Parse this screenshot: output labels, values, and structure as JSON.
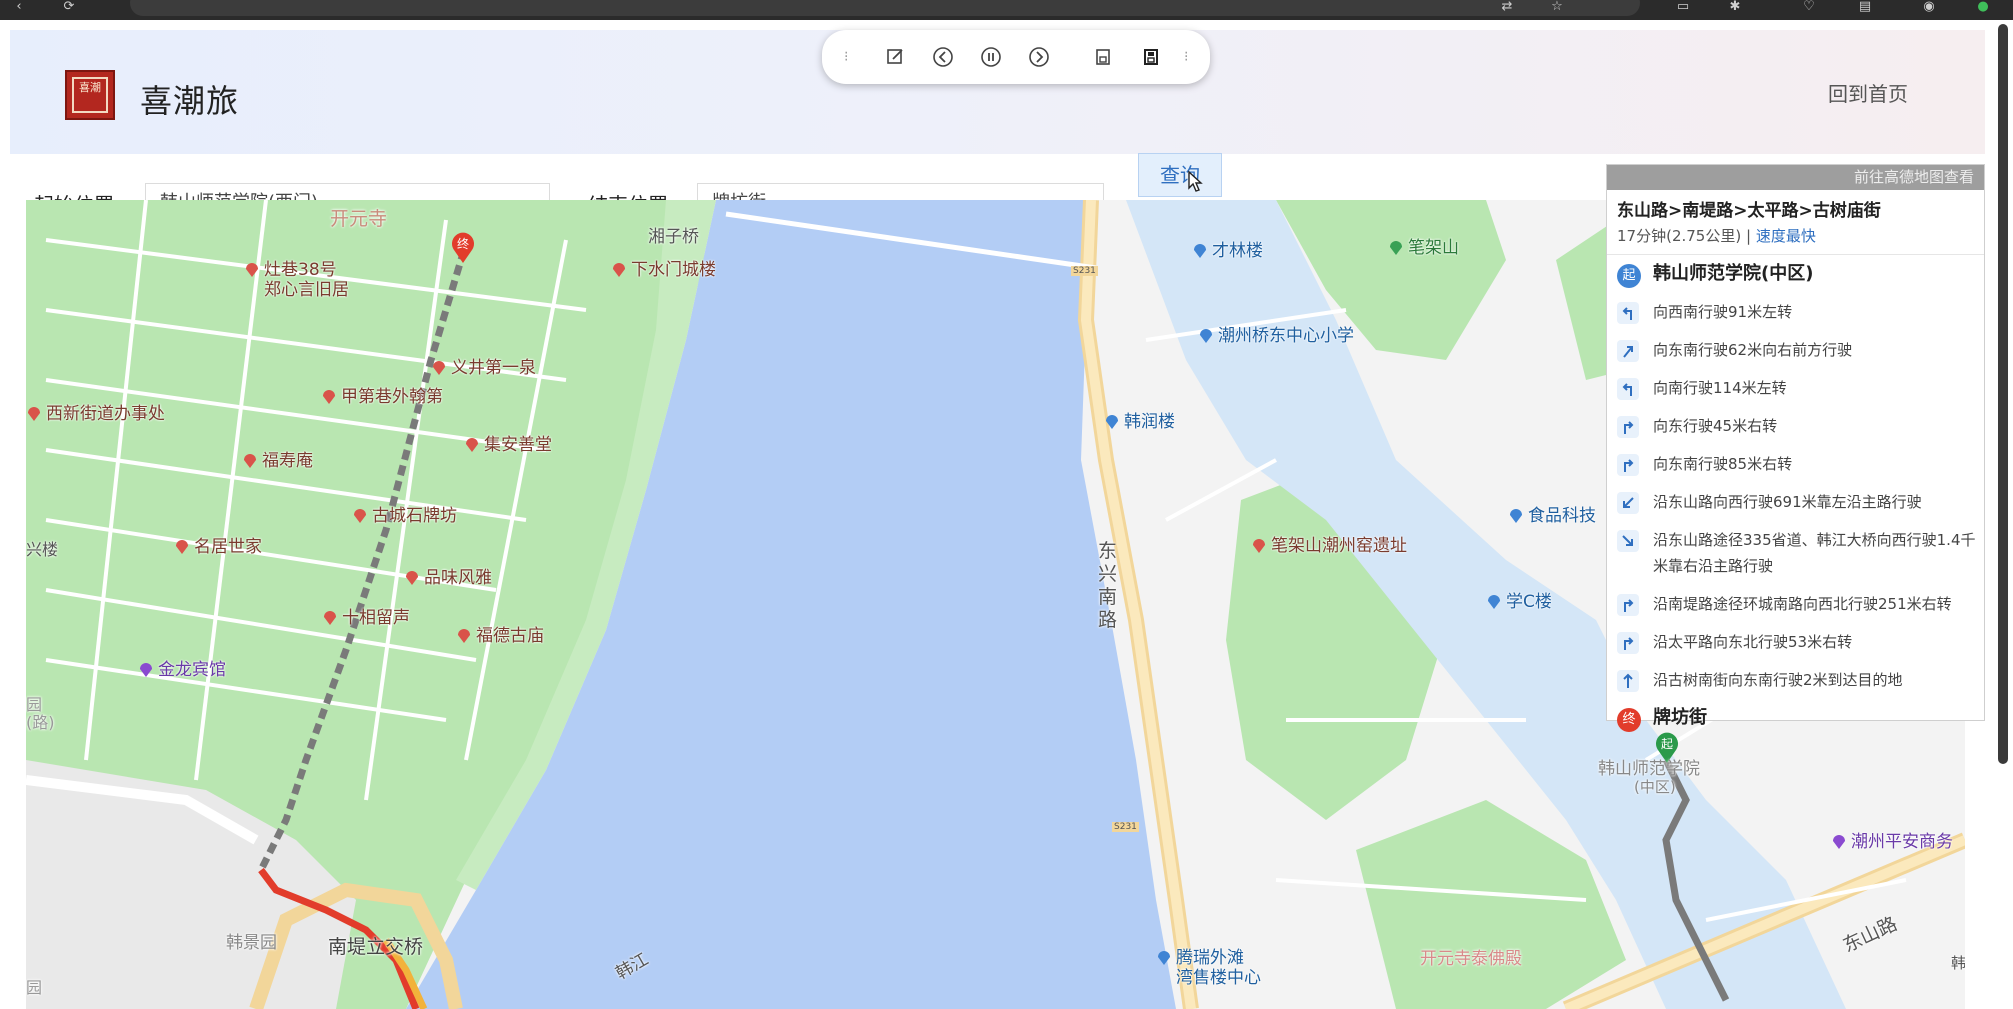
{
  "app": {
    "title": "喜潮旅",
    "logo_text": "喜潮",
    "home_link": "回到首页"
  },
  "toolbar": {
    "icons": [
      "edit-icon",
      "prev-icon",
      "pause-icon",
      "next-icon",
      "save-icon",
      "save-as-icon"
    ]
  },
  "search": {
    "start_label": "起始位置:",
    "start_value": "韩山师范学院(西门)",
    "end_label": "结束位置:",
    "end_value": "牌坊街",
    "query_button": "查询"
  },
  "route_panel": {
    "header_link": "前往高德地图查看",
    "summary": "东山路>南堤路>太平路>古树庙街",
    "time_distance": "17分钟(2.75公里)",
    "separator": "|",
    "speed_tag": "速度最快",
    "start_badge": "起",
    "start_name": "韩山师范学院(中区)",
    "end_badge": "终",
    "end_name": "牌坊街",
    "steps": [
      {
        "icon": "turn-left-icon",
        "text": "向西南行驶91米左转"
      },
      {
        "icon": "bear-right-icon",
        "text": "向东南行驶62米向右前方行驶"
      },
      {
        "icon": "turn-left-icon",
        "text": "向南行驶114米左转"
      },
      {
        "icon": "turn-right-icon",
        "text": "向东行驶45米右转"
      },
      {
        "icon": "turn-right-icon",
        "text": "向东南行驶85米右转"
      },
      {
        "icon": "keep-left-icon",
        "text": "沿东山路向西行驶691米靠左沿主路行驶"
      },
      {
        "icon": "keep-right-icon",
        "text": "沿东山路途径335省道、韩江大桥向西行驶1.4千米靠右沿主路行驶"
      },
      {
        "icon": "turn-right-icon",
        "text": "沿南堤路途径环城南路向西北行驶251米右转"
      },
      {
        "icon": "turn-right-icon",
        "text": "沿太平路向东北行驶53米右转"
      },
      {
        "icon": "straight-icon",
        "text": "沿古树南街向东南行驶2米到达目的地"
      }
    ]
  },
  "map": {
    "pois": [
      {
        "name": "灶巷38号",
        "sub": "郑心言旧居",
        "kind": "red"
      },
      {
        "name": "下水门城楼",
        "kind": "red"
      },
      {
        "name": "义井第一泉",
        "kind": "red"
      },
      {
        "name": "甲第巷外翰第",
        "kind": "red"
      },
      {
        "name": "西新街道办事处",
        "kind": "red"
      },
      {
        "name": "集安善堂",
        "kind": "red"
      },
      {
        "name": "福寿庵",
        "kind": "red"
      },
      {
        "name": "古城石牌坊",
        "kind": "red"
      },
      {
        "name": "名居世家",
        "kind": "red"
      },
      {
        "name": "品味风雅",
        "kind": "red"
      },
      {
        "name": "十相留声",
        "kind": "red"
      },
      {
        "name": "福德古庙",
        "kind": "red"
      },
      {
        "name": "金龙宾馆",
        "kind": "purple"
      },
      {
        "name": "才林楼",
        "kind": "blue"
      },
      {
        "name": "笔架山",
        "kind": "green"
      },
      {
        "name": "潮州桥东中心小学",
        "kind": "blue"
      },
      {
        "name": "韩润楼",
        "kind": "blue"
      },
      {
        "name": "食品科技",
        "kind": "blue"
      },
      {
        "name": "笔架山潮州窑遗址",
        "kind": "red"
      },
      {
        "name": "学C楼",
        "kind": "blue"
      },
      {
        "name": "腾瑞外滩",
        "sub": "湾售楼中心",
        "kind": "blue"
      },
      {
        "name": "潮州平安商务",
        "kind": "purple"
      }
    ],
    "labels": {
      "kaiyuan_top": "开元寺",
      "xiangzi_bridge": "湘子桥",
      "road_331_a": "S231",
      "road_331_b": "S231",
      "dongxing": "东兴南路",
      "nandi_bridge": "南堤立交桥",
      "hanjiang": "韩江",
      "hanjing": "韩景园",
      "kaiyuan_bottom": "开元寺泰佛殿",
      "dongshan_road": "东山路",
      "hanshan_campus": "韩山师范学院",
      "hanshan_zhong": "(中区)",
      "xing_lou": "兴楼",
      "yuan_lu": "园(路)",
      "yuan2": "园",
      "han_right": "韩",
      "start_marker": "起",
      "end_marker": "终"
    }
  }
}
